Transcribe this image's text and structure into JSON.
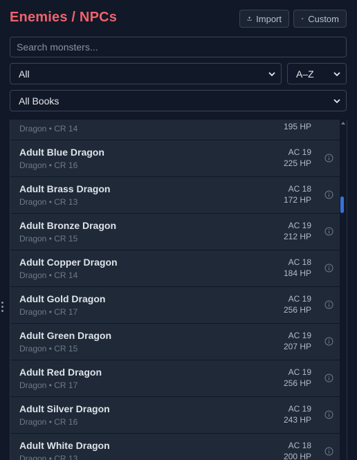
{
  "header": {
    "title": "Enemies / NPCs",
    "import_label": "Import",
    "custom_label": "Custom"
  },
  "search": {
    "placeholder": "Search monsters..."
  },
  "filters": {
    "type_selected": "All",
    "sort_selected": "A–Z",
    "books_selected": "All Books"
  },
  "list": {
    "partial_top": {
      "sub": "Dragon • CR 14",
      "hp": "195 HP"
    },
    "items": [
      {
        "name": "Adult Blue Dragon",
        "sub": "Dragon • CR 16",
        "ac": "AC 19",
        "hp": "225 HP"
      },
      {
        "name": "Adult Brass Dragon",
        "sub": "Dragon • CR 13",
        "ac": "AC 18",
        "hp": "172 HP"
      },
      {
        "name": "Adult Bronze Dragon",
        "sub": "Dragon • CR 15",
        "ac": "AC 19",
        "hp": "212 HP"
      },
      {
        "name": "Adult Copper Dragon",
        "sub": "Dragon • CR 14",
        "ac": "AC 18",
        "hp": "184 HP"
      },
      {
        "name": "Adult Gold Dragon",
        "sub": "Dragon • CR 17",
        "ac": "AC 19",
        "hp": "256 HP"
      },
      {
        "name": "Adult Green Dragon",
        "sub": "Dragon • CR 15",
        "ac": "AC 19",
        "hp": "207 HP"
      },
      {
        "name": "Adult Red Dragon",
        "sub": "Dragon • CR 17",
        "ac": "AC 19",
        "hp": "256 HP"
      },
      {
        "name": "Adult Silver Dragon",
        "sub": "Dragon • CR 16",
        "ac": "AC 19",
        "hp": "243 HP"
      },
      {
        "name": "Adult White Dragon",
        "sub": "Dragon • CR 13",
        "ac": "AC 18",
        "hp": "200 HP"
      }
    ]
  },
  "icons": {
    "import": "upload-icon",
    "custom": "plus-icon",
    "info": "info-icon",
    "select": "chevron-down-icon",
    "grip": "drag-handle-icon"
  },
  "colors": {
    "title": "#f0626c",
    "background": "#111827",
    "row": "#1f2937",
    "scroll_thumb": "#3b82f6"
  }
}
